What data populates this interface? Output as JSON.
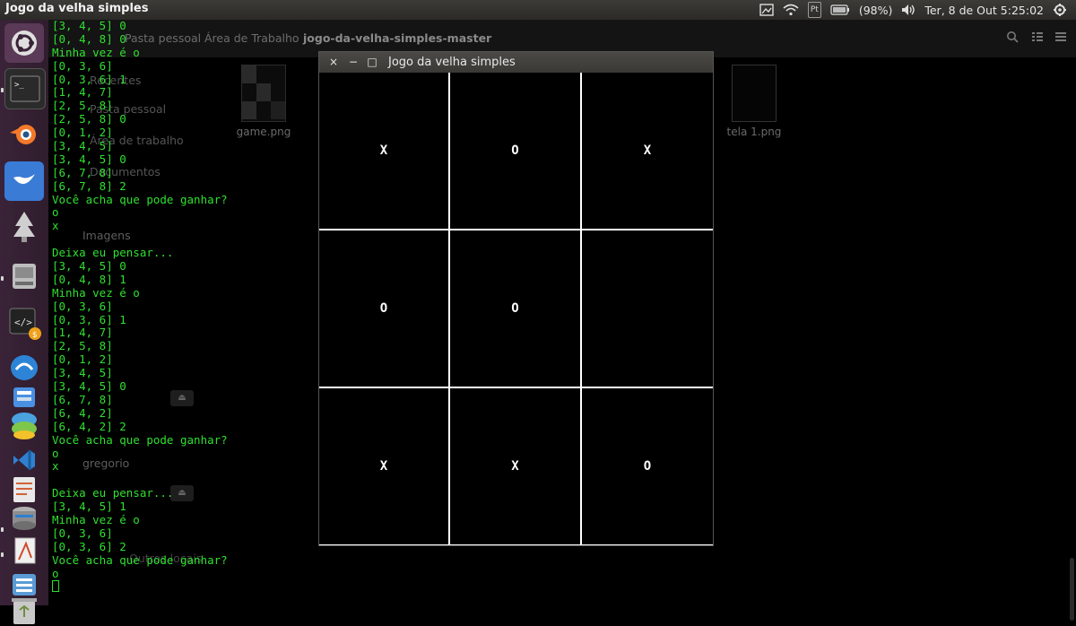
{
  "topbar": {
    "app_title": "Jogo da velha simples",
    "battery": "(98%)",
    "datetime": "Ter,  8 de Out  5:25:02",
    "keyboard_badge": "Pt",
    "icons": [
      "graphics-tray-icon",
      "wifi-icon",
      "keyboard-layout-icon",
      "battery-icon",
      "volume-icon",
      "power-gear-icon"
    ]
  },
  "launcher": {
    "items": [
      "ubuntu-dash",
      "terminal",
      "blender",
      "shotwell",
      "inkscape",
      "files",
      "code-editor",
      "app-store",
      "software-center",
      "color-app",
      "vscode",
      "text-editor",
      "disk-utility",
      "document-viewer",
      "sublime-text",
      "trash"
    ]
  },
  "filemanager": {
    "breadcrumbs": [
      "Pasta pessoal",
      "Área de Trabalho",
      "jogo-da-velha-simples-master"
    ],
    "sidebar": [
      "Recentes",
      "Pasta pessoal",
      "Área de trabalho",
      "Documentos",
      "Imagens",
      "gregorio",
      "Outros locais"
    ],
    "files": [
      {
        "name": "game.png"
      },
      {
        "name": "tela 1.png"
      }
    ]
  },
  "terminal": {
    "lines": [
      "[3, 4, 5] 0",
      "[0, 4, 8] 0",
      "Minha vez é o",
      "[0, 3, 6]",
      "[0, 3, 6] 1",
      "[1, 4, 7]",
      "[2, 5, 8]",
      "[2, 5, 8] 0",
      "[0, 1, 2]",
      "[3, 4, 5]",
      "[3, 4, 5] 0",
      "[6, 7, 8]",
      "[6, 7, 8] 2",
      "Você acha que pode ganhar?",
      "o",
      "x",
      "",
      "Deixa eu pensar...",
      "[3, 4, 5] 0",
      "[0, 4, 8] 1",
      "Minha vez é o",
      "[0, 3, 6]",
      "[0, 3, 6] 1",
      "[1, 4, 7]",
      "[2, 5, 8]",
      "[0, 1, 2]",
      "[3, 4, 5]",
      "[3, 4, 5] 0",
      "[6, 7, 8]",
      "[6, 4, 2]",
      "[6, 4, 2] 2",
      "Você acha que pode ganhar?",
      "o",
      "x",
      "",
      "Deixa eu pensar...",
      "[3, 4, 5] 1",
      "Minha vez é o",
      "[0, 3, 6]",
      "[0, 3, 6] 2",
      "Você acha que pode ganhar?",
      "o"
    ]
  },
  "game": {
    "window_title": "Jogo da velha simples",
    "close_glyph": "×",
    "minimize_glyph": "−",
    "maximize_glyph": "□",
    "cells": [
      "X",
      "O",
      "X",
      "O",
      "O",
      "",
      "X",
      "X",
      "O"
    ]
  }
}
